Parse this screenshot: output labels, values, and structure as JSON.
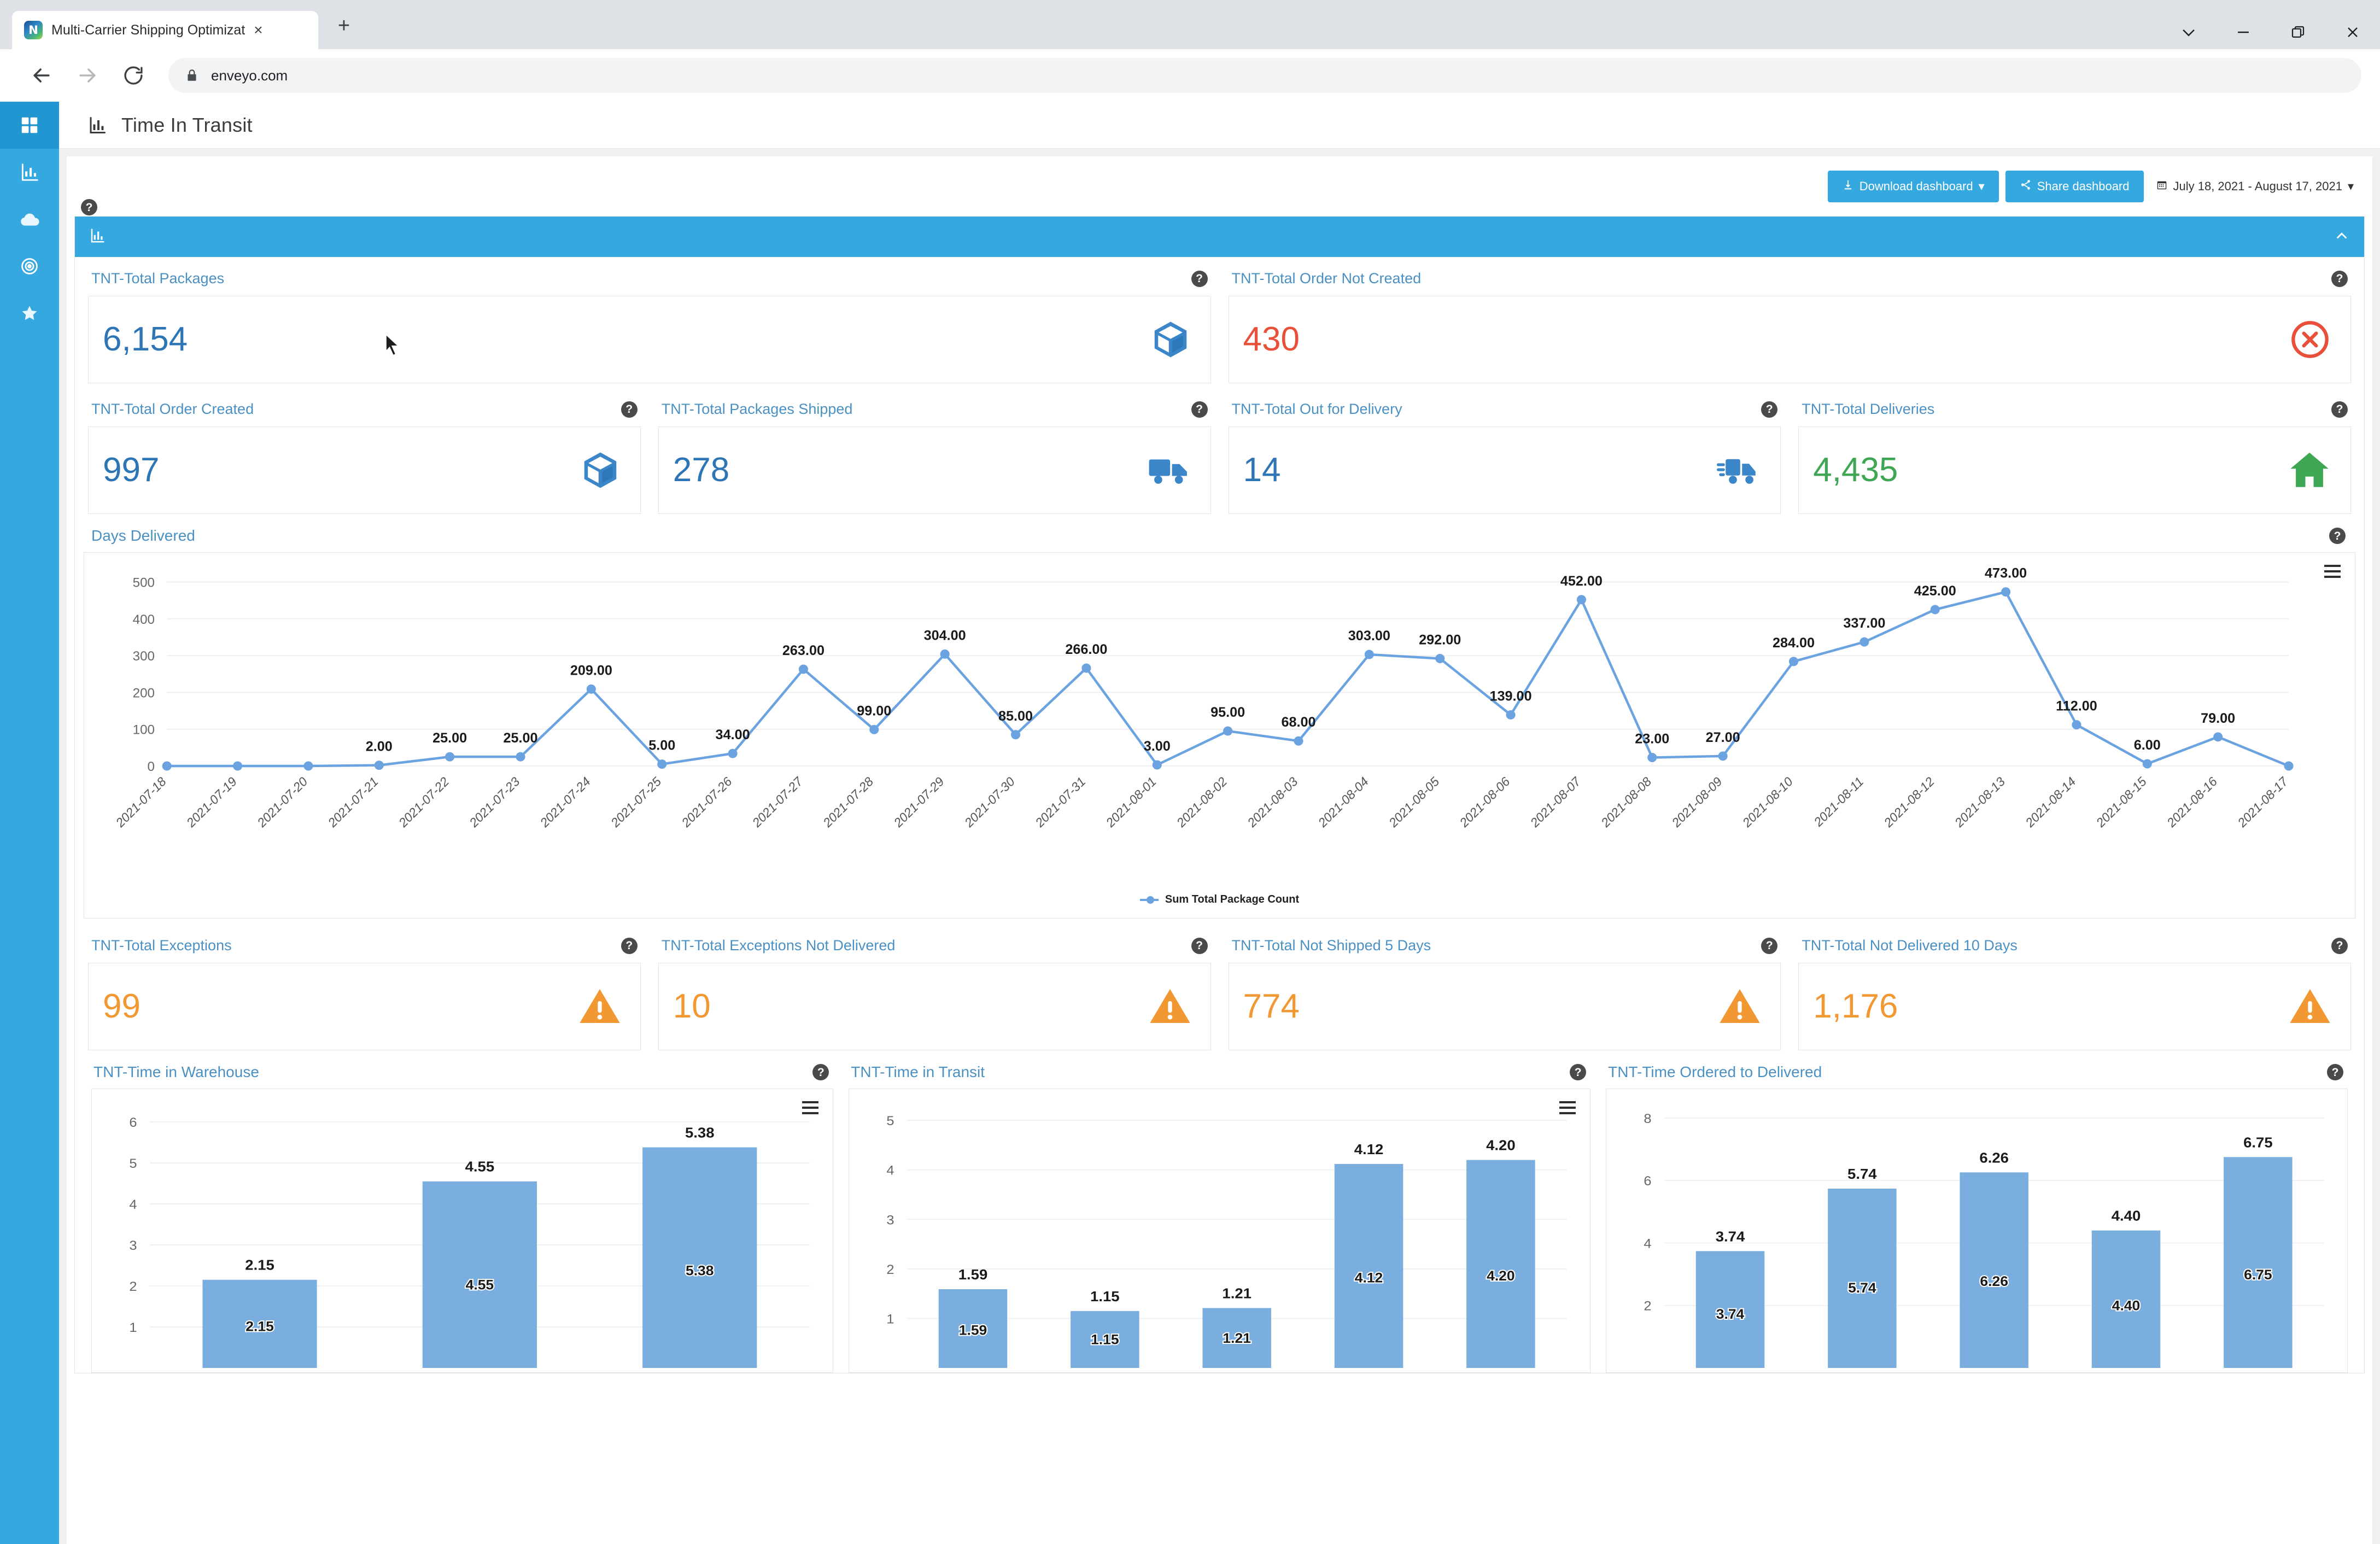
{
  "browser": {
    "tab_title": "Multi-Carrier Shipping Optimizat",
    "tab_close_glyph": "×",
    "newtab_glyph": "+",
    "url": "enveyo.com",
    "favicon_text": "N"
  },
  "sidebar": {
    "items": [
      {
        "name": "dashboard-grid",
        "icon": "grid-icon",
        "active": true
      },
      {
        "name": "analytics",
        "icon": "bar-chart-icon",
        "active": false
      },
      {
        "name": "cloud",
        "icon": "cloud-icon",
        "active": false
      },
      {
        "name": "target",
        "icon": "target-icon",
        "active": false
      },
      {
        "name": "favorites",
        "icon": "star-icon",
        "active": false
      }
    ]
  },
  "header": {
    "icon": "bar-chart-icon",
    "title": "Time In Transit"
  },
  "toolbar": {
    "download_label": "Download dashboard",
    "download_caret": "▾",
    "share_label": "Share dashboard",
    "date_range": "July 18, 2021 - August 17, 2021",
    "date_caret": "▾",
    "help_glyph": "?"
  },
  "panel": {
    "icon": "bar-chart-icon",
    "collapse_icon": "chevron-up-icon"
  },
  "kpis_row1": [
    {
      "label": "TNT-Total Packages",
      "value": "6,154",
      "color_class": "blue",
      "icon": "box-icon",
      "help": "?"
    },
    {
      "label": "TNT-Total Order Not Created",
      "value": "430",
      "color_class": "red",
      "icon": "error-circle-icon",
      "help": "?"
    }
  ],
  "kpis_row2": [
    {
      "label": "TNT-Total Order Created",
      "value": "997",
      "color_class": "blue",
      "icon": "box-icon",
      "help": "?"
    },
    {
      "label": "TNT-Total Packages Shipped",
      "value": "278",
      "color_class": "blue",
      "icon": "truck-icon",
      "help": "?"
    },
    {
      "label": "TNT-Total Out for Delivery",
      "value": "14",
      "color_class": "blue",
      "icon": "truck-moving-icon",
      "help": "?"
    },
    {
      "label": "TNT-Total Deliveries",
      "value": "4,435",
      "color_class": "green",
      "icon": "home-icon",
      "help": "?"
    }
  ],
  "kpis_row3": [
    {
      "label": "TNT-Total Exceptions",
      "value": "99",
      "color_class": "orange",
      "icon": "warning-triangle-icon",
      "help": "?"
    },
    {
      "label": "TNT-Total Exceptions Not Delivered",
      "value": "10",
      "color_class": "orange",
      "icon": "warning-triangle-icon",
      "help": "?"
    },
    {
      "label": "TNT-Total Not Shipped 5 Days",
      "value": "774",
      "color_class": "orange",
      "icon": "warning-triangle-icon",
      "help": "?"
    },
    {
      "label": "TNT-Total Not Delivered 10 Days",
      "value": "1,176",
      "color_class": "orange",
      "icon": "warning-triangle-icon",
      "help": "?"
    }
  ],
  "days_delivered": {
    "title": "Days Delivered",
    "help": "?"
  },
  "bottom_titles": [
    {
      "title": "TNT-Time in Warehouse",
      "help": "?"
    },
    {
      "title": "TNT-Time in Transit",
      "help": "?"
    },
    {
      "title": "TNT-Time Ordered to Delivered",
      "help": "?"
    }
  ],
  "chart_data": [
    {
      "type": "line",
      "title": "Days Delivered",
      "xlabel": "",
      "ylabel": "",
      "ylim": [
        0,
        520
      ],
      "yticks": [
        0,
        100,
        200,
        300,
        400,
        500
      ],
      "grid": true,
      "legend_position": "bottom",
      "legend": [
        "Sum Total Package Count"
      ],
      "series_color": "#6aa3e0",
      "categories": [
        "2021-07-18",
        "2021-07-19",
        "2021-07-20",
        "2021-07-21",
        "2021-07-22",
        "2021-07-23",
        "2021-07-24",
        "2021-07-25",
        "2021-07-26",
        "2021-07-27",
        "2021-07-28",
        "2021-07-29",
        "2021-07-30",
        "2021-07-31",
        "2021-08-01",
        "2021-08-02",
        "2021-08-03",
        "2021-08-04",
        "2021-08-05",
        "2021-08-06",
        "2021-08-07",
        "2021-08-08",
        "2021-08-09",
        "2021-08-10",
        "2021-08-11",
        "2021-08-12",
        "2021-08-13",
        "2021-08-14",
        "2021-08-15",
        "2021-08-16",
        "2021-08-17"
      ],
      "series": [
        {
          "name": "Sum Total Package Count",
          "values": [
            0,
            0,
            0,
            2,
            25,
            25,
            209,
            5,
            34,
            263,
            99,
            304,
            85,
            266,
            3,
            95,
            68,
            303,
            292,
            139,
            452,
            23,
            27,
            284,
            337,
            425,
            473,
            112,
            6,
            79,
            0
          ],
          "labels": [
            "",
            "",
            "",
            "2.00",
            "25.00",
            "25.00",
            "209.00",
            "5.00",
            "34.00",
            "263.00",
            "99.00",
            "304.00",
            "85.00",
            "266.00",
            "3.00",
            "95.00",
            "68.00",
            "303.00",
            "292.00",
            "139.00",
            "452.00",
            "23.00",
            "27.00",
            "284.00",
            "337.00",
            "425.00",
            "473.00",
            "112.00",
            "6.00",
            "79.00",
            ""
          ]
        }
      ]
    },
    {
      "type": "bar",
      "title": "TNT-Time in Warehouse",
      "ylim": [
        0,
        6.4
      ],
      "yticks": [
        1,
        2,
        3,
        4,
        5,
        6
      ],
      "grid": true,
      "categories": [
        "",
        "",
        ""
      ],
      "values": [
        2.15,
        4.55,
        5.38
      ],
      "labels": [
        "2.15",
        "4.55",
        "5.38"
      ],
      "bar_color": "#7aaede"
    },
    {
      "type": "bar",
      "title": "TNT-Time in Transit",
      "ylim": [
        0,
        5.3
      ],
      "yticks": [
        1,
        2,
        3,
        4,
        5
      ],
      "grid": true,
      "categories": [
        "",
        "",
        "",
        "",
        ""
      ],
      "values": [
        1.59,
        1.15,
        1.21,
        4.12,
        4.2
      ],
      "labels": [
        "1.59",
        "1.15",
        "1.21",
        "4.12",
        "4.20"
      ],
      "bar_color": "#7aaede"
    },
    {
      "type": "bar",
      "title": "TNT-Time Ordered to Delivered",
      "ylim": [
        0,
        8.4
      ],
      "yticks": [
        2,
        4,
        6,
        8
      ],
      "grid": true,
      "categories": [
        "",
        "",
        "",
        "",
        ""
      ],
      "values": [
        3.74,
        5.74,
        6.26,
        4.4,
        6.75
      ],
      "labels": [
        "3.74",
        "5.74",
        "6.26",
        "4.40",
        "6.75"
      ],
      "bar_color": "#7aaede"
    }
  ],
  "colors": {
    "accent_blue": "#35a8e0",
    "kpi_blue": "#2e75b6",
    "kpi_red": "#e8503a",
    "kpi_green": "#3fa754",
    "kpi_orange": "#f29833",
    "label_blue": "#4a90c2",
    "series_blue": "#6aa3e0",
    "bar_blue": "#7aaede"
  }
}
